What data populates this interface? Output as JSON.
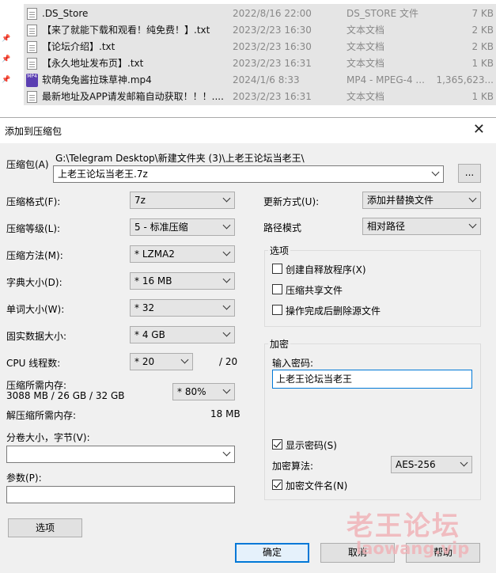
{
  "files": [
    {
      "icon": "file-icon",
      "name": ".DS_Store",
      "date": "2022/8/16 22:00",
      "type": "DS_STORE 文件",
      "size": "7 KB"
    },
    {
      "icon": "text-file-icon",
      "name": "【来了就能下载和观看！纯免费！】.txt",
      "date": "2023/2/23 16:30",
      "type": "文本文档",
      "size": "2 KB"
    },
    {
      "icon": "text-file-icon",
      "name": "【论坛介绍】.txt",
      "date": "2023/2/23 16:30",
      "type": "文本文档",
      "size": "2 KB"
    },
    {
      "icon": "text-file-icon",
      "name": "【永久地址发布页】.txt",
      "date": "2023/2/23 16:31",
      "type": "文本文档",
      "size": "1 KB"
    },
    {
      "icon": "mp4-file-icon",
      "name": "软萌兔兔酱拉珠草神.mp4",
      "date": "2024/1/6 8:33",
      "type": "MP4 - MPEG-4 ...",
      "size": "1,365,623..."
    },
    {
      "icon": "text-file-icon",
      "name": "最新地址及APP请发邮箱自动获取！！！....",
      "date": "2023/2/23 16:31",
      "type": "文本文档",
      "size": "1 KB"
    }
  ],
  "mp4_icon_text": "MP4",
  "dialog": {
    "title": "添加到压缩包",
    "close_glyph": "✕",
    "archive_label": "压缩包(A)",
    "archive_path": "G:\\Telegram Desktop\\新建文件夹 (3)\\上老王论坛当老王\\",
    "archive_name": "上老王论坛当老王.7z",
    "browse_label": "...",
    "format_label": "压缩格式(F):",
    "format_value": "7z",
    "level_label": "压缩等级(L):",
    "level_value": "5 - 标准压缩",
    "method_label": "压缩方法(M):",
    "method_value": "* LZMA2",
    "dict_label": "字典大小(D):",
    "dict_value": "* 16 MB",
    "word_label": "单词大小(W):",
    "word_value": "* 32",
    "solid_label": "固实数据大小:",
    "solid_value": "* 4 GB",
    "cpu_label": "CPU 线程数:",
    "cpu_value": "* 20",
    "cpu_total": "/ 20",
    "mem_comp_label": "压缩所需内存:",
    "mem_comp_detail": "3088 MB / 26 GB / 32 GB",
    "mem_percent": "* 80%",
    "mem_decomp_label": "解压缩所需内存:",
    "mem_decomp_value": "18 MB",
    "split_label": "分卷大小，字节(V):",
    "split_value": "",
    "params_label": "参数(P):",
    "params_value": "",
    "options_button": "选项",
    "update_label": "更新方式(U):",
    "update_value": "添加并替换文件",
    "path_mode_label": "路径模式",
    "path_mode_value": "相对路径",
    "options_group": "选项",
    "opt_sfx": "创建自释放程序(X)",
    "opt_shared": "压缩共享文件",
    "opt_delete": "操作完成后删除源文件",
    "encryption_group": "加密",
    "password_label": "输入密码:",
    "password_value": "上老王论坛当老王",
    "show_password": "显示密码(S)",
    "enc_method_label": "加密算法:",
    "enc_method_value": "AES-256",
    "encrypt_names": "加密文件名(N)",
    "ok_button": "确定",
    "cancel_button": "取消",
    "help_button": "帮助"
  },
  "checkboxes": {
    "sfx": false,
    "shared": false,
    "delete": false,
    "show_password": true,
    "encrypt_names": true
  },
  "watermark": {
    "text": "老王论坛",
    "sub": "laowang.vip"
  }
}
